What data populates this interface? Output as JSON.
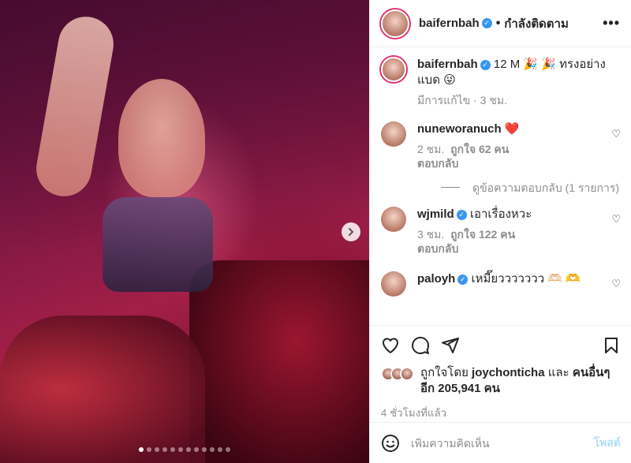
{
  "header": {
    "username": "baifernbah",
    "separator": "•",
    "follow_status": "กำลังติดตาม",
    "more_label": "•••"
  },
  "caption": {
    "username": "baifernbah",
    "text": "12 M 🎉 🎉 ทรงอย่างแบด 😜",
    "meta": "มีการแก้ไข · 3 ชม."
  },
  "comments": [
    {
      "username": "nuneworanuch",
      "text": "❤️",
      "time": "2 ชม.",
      "likes": "ถูกใจ 62 คน",
      "reply": "ตอบกลับ",
      "verified": false
    },
    {
      "username": "wjmild",
      "text": "เอาเรื่องหวะ",
      "time": "3 ชม.",
      "likes": "ถูกใจ 122 คน",
      "reply": "ตอบกลับ",
      "verified": true
    },
    {
      "username": "paloyh",
      "text": "เหมี๊ยววววววว 🫶🏻 🫶",
      "verified": true
    }
  ],
  "view_replies": "ดูข้อความตอบกลับ (1 รายการ)",
  "likes": {
    "prefix": "ถูกใจโดย",
    "user": "joychonticha",
    "and": "และ",
    "others": "คนอื่นๆ อีก 205,941 คน"
  },
  "timestamp": "4 ชั่วโมงที่แล้ว",
  "add_comment": {
    "placeholder": "เพิ่มความคิดเห็น",
    "post_label": "โพสต์"
  },
  "icons": [
    "heart-icon",
    "comment-icon",
    "share-icon",
    "bookmark-icon",
    "emoji-icon",
    "chevron-right-icon"
  ],
  "colors": {
    "verified": "#3897f0",
    "story_ring": "#e1306c",
    "post_disabled": "#b2dffc",
    "heart_red": "#ed4956"
  },
  "carousel": {
    "slides": 12,
    "active_index": 0
  }
}
